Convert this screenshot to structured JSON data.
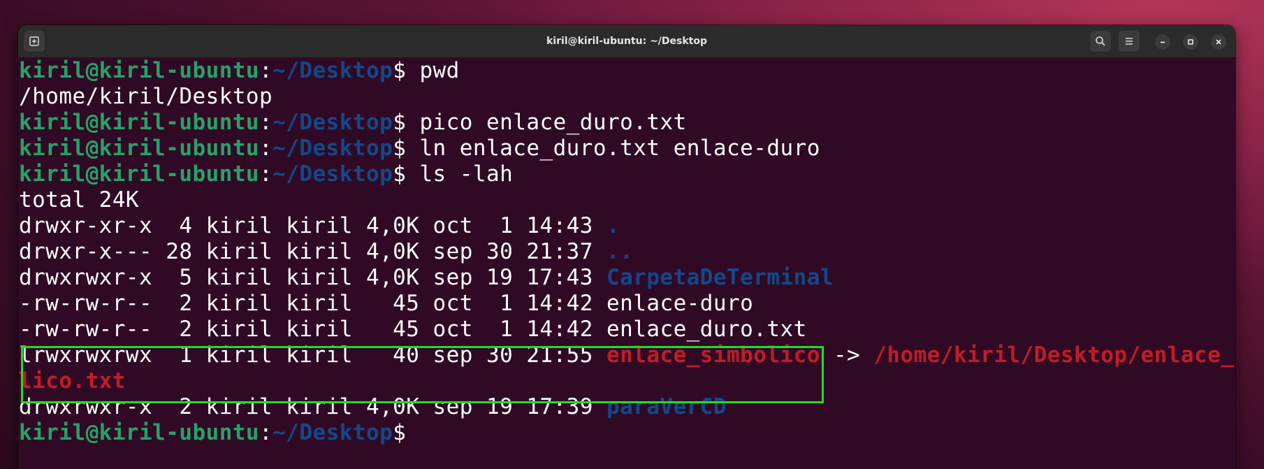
{
  "window": {
    "title": "kiril@kiril-ubuntu: ~/Desktop"
  },
  "colors": {
    "prompt_user": "#26a269",
    "directory": "#12488b",
    "symlink": "#c01c28",
    "highlight_box": "#22dd22",
    "terminal_bg": "#300a24"
  },
  "icons": {
    "new_tab": "new-tab-icon",
    "search": "search-icon",
    "menu": "hamburger-menu-icon",
    "minimize": "minimize-icon",
    "maximize": "maximize-icon",
    "close": "close-icon"
  },
  "terminal": {
    "prompt_user": "kiril@kiril-ubuntu",
    "prompt_sep": ":",
    "prompt_path": "~/Desktop",
    "prompt_symbol": "$ ",
    "lines": [
      {
        "cmd": "pwd"
      },
      {
        "out": "/home/kiril/Desktop"
      },
      {
        "cmd": "pico enlace_duro.txt"
      },
      {
        "cmd": "ln enlace_duro.txt enlace-duro"
      },
      {
        "cmd": "ls -lah"
      },
      {
        "out": "total 24K"
      }
    ],
    "listing": [
      {
        "meta": "drwxr-xr-x  4 kiril kiril 4,0K oct  1 14:43 ",
        "name": "."
      },
      {
        "meta": "drwxr-x--- 28 kiril kiril 4,0K sep 30 21:37 ",
        "name": ".."
      },
      {
        "meta": "drwxrwxr-x  5 kiril kiril 4,0K sep 19 17:43 ",
        "name": "CarpetaDeTerminal"
      },
      {
        "meta": "-rw-rw-r--  2 kiril kiril   45 oct  1 14:42 ",
        "name": "enlace-duro"
      },
      {
        "meta": "-rw-rw-r--  2 kiril kiril   45 oct  1 14:42 ",
        "name": "enlace_duro.txt"
      },
      {
        "meta": "lrwxrwxrwx  1 kiril kiril   40 sep 30 21:55 ",
        "name": "enlace_simbolico",
        "arrow": " -> ",
        "target_part1": "/home/kiril/Desktop/enlace_simbo",
        "target_part2": "lico.txt"
      },
      {
        "meta": "drwxrwxr-x  2 kiril kiril 4,0K sep 19 17:39 ",
        "name": "paraVerCD"
      }
    ]
  }
}
